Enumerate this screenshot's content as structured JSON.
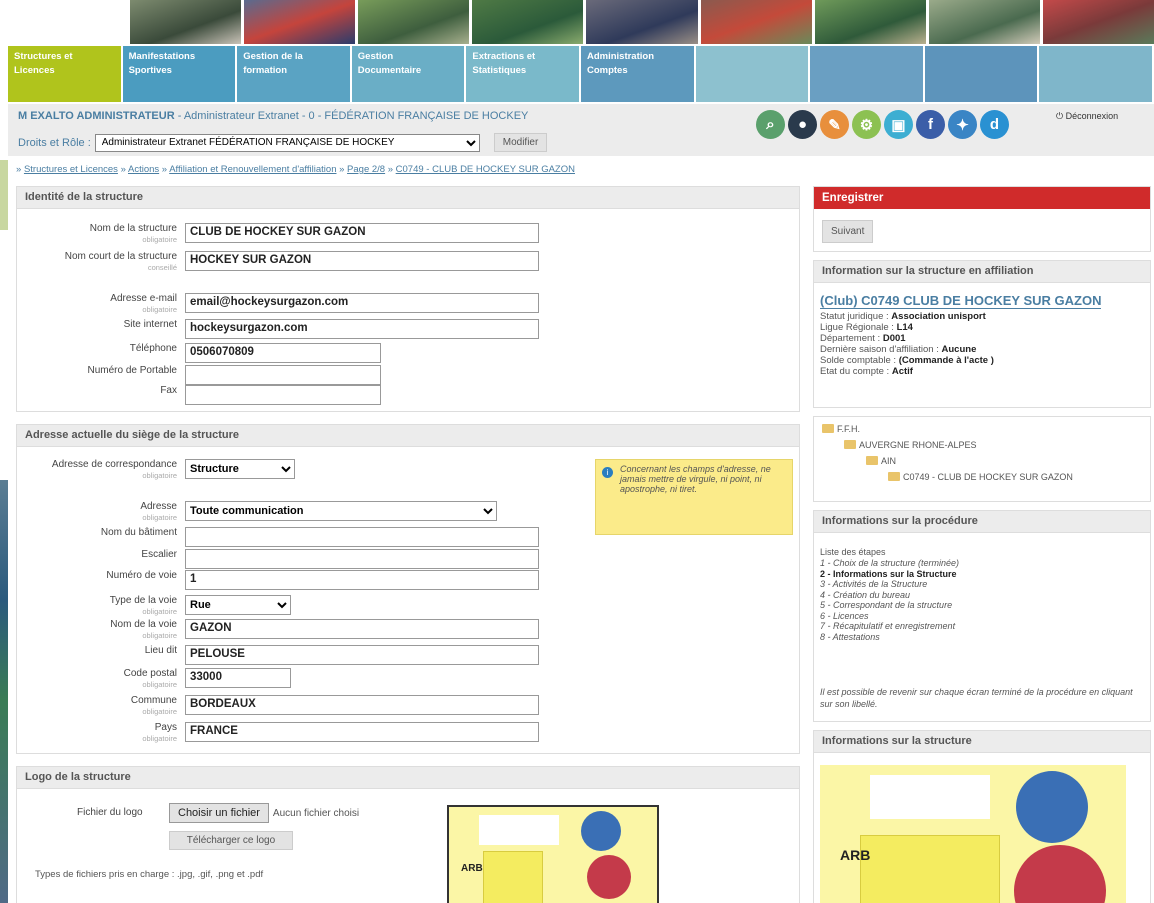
{
  "nav": {
    "items": [
      {
        "label": "Structures et Licences",
        "color": "#b0c41c"
      },
      {
        "label": "Manifestations Sportives",
        "color": "#4b9cc0"
      },
      {
        "label": "Gestion de la formation",
        "color": "#5aa3c3"
      },
      {
        "label": "Gestion Documentaire",
        "color": "#6aaec6"
      },
      {
        "label": "Extractions et Statistiques",
        "color": "#7ab9ca"
      },
      {
        "label": "Administration Comptes",
        "color": "#5d99bd"
      },
      {
        "label": "",
        "color": "#8dc1cf"
      },
      {
        "label": "",
        "color": "#6a9fc2"
      },
      {
        "label": "",
        "color": "#5d94bb"
      },
      {
        "label": "",
        "color": "#7fb6ca"
      }
    ]
  },
  "user": {
    "name": "M EXALTO ADMINISTRATEUR",
    "info": "- Administrateur Extranet - 0 - FÉDÉRATION FRANÇAISE DE HOCKEY",
    "role_label": "Droits et Rôle :",
    "role_value": "Administrateur Extranet FÉDÉRATION FRANÇAISE DE HOCKEY",
    "modify_label": "Modifier",
    "logout_label": "Déconnexion"
  },
  "icons": [
    {
      "name": "search-icon",
      "glyph": "⌕",
      "color": "#5aa06c"
    },
    {
      "name": "user-icon",
      "glyph": "●",
      "color": "#2a3a4c"
    },
    {
      "name": "edit-icon",
      "glyph": "✎",
      "color": "#e88f3c"
    },
    {
      "name": "settings-icon",
      "glyph": "⚙",
      "color": "#8cc152"
    },
    {
      "name": "lock-icon",
      "glyph": "▣",
      "color": "#3caed2"
    },
    {
      "name": "facebook-icon",
      "glyph": "f",
      "color": "#3b5ea8"
    },
    {
      "name": "twitter-icon",
      "glyph": "✦",
      "color": "#3a85c5"
    },
    {
      "name": "dailymotion-icon",
      "glyph": "d",
      "color": "#2a91d2"
    }
  ],
  "breadcrumb": {
    "items": [
      "Structures et Licences",
      "Actions",
      "Affiliation et Renouvellement d'affiliation",
      "Page 2/8",
      "C0749 - CLUB DE HOCKEY SUR GAZON"
    ]
  },
  "identity": {
    "title": "Identité de la structure",
    "fields": [
      {
        "label": "Nom de la structure",
        "note": "obligatoire",
        "value": "CLUB DE HOCKEY SUR GAZON"
      },
      {
        "label": "Nom court de la structure",
        "note": "conseillé",
        "value": "HOCKEY SUR GAZON"
      },
      {
        "label": "Adresse e-mail",
        "note": "obligatoire",
        "value": "email@hockeysurgazon.com"
      },
      {
        "label": "Site internet",
        "note": "",
        "value": "hockeysurgazon.com"
      },
      {
        "label": "Téléphone",
        "note": "",
        "value": "0506070809"
      },
      {
        "label": "Numéro de Portable",
        "note": "",
        "value": ""
      },
      {
        "label": "Fax",
        "note": "",
        "value": ""
      }
    ]
  },
  "address": {
    "title": "Adresse actuelle du siège de la structure",
    "info": "Concernant les champs d'adresse, ne jamais mettre de virgule, ni point, ni apostrophe, ni tiret.",
    "fields": [
      {
        "label": "Adresse de correspondance",
        "note": "obligatoire",
        "value": "Structure",
        "type": "select"
      },
      {
        "label": "Adresse",
        "note": "obligatoire",
        "value": "Toute communication",
        "type": "select"
      },
      {
        "label": "Nom du bâtiment",
        "note": "",
        "value": "",
        "type": "text"
      },
      {
        "label": "Escalier",
        "note": "",
        "value": "",
        "type": "text"
      },
      {
        "label": "Numéro de voie",
        "note": "",
        "value": "1",
        "type": "text"
      },
      {
        "label": "Type de la voie",
        "note": "obligatoire",
        "value": "Rue",
        "type": "select"
      },
      {
        "label": "Nom de la voie",
        "note": "obligatoire",
        "value": "GAZON",
        "type": "text"
      },
      {
        "label": "Lieu dit",
        "note": "",
        "value": "PELOUSE",
        "type": "text"
      },
      {
        "label": "Code postal",
        "note": "obligatoire",
        "value": "33000",
        "type": "text"
      },
      {
        "label": "Commune",
        "note": "obligatoire",
        "value": "BORDEAUX",
        "type": "text"
      },
      {
        "label": "Pays",
        "note": "obligatoire",
        "value": "FRANCE",
        "type": "text"
      }
    ]
  },
  "logo": {
    "title": "Logo de la structure",
    "file_label": "Fichier du logo",
    "choose_label": "Choisir un fichier",
    "no_file": "Aucun fichier choisi",
    "upload_label": "Télécharger ce logo",
    "types": "Types de fichiers pris en charge : .jpg, .gif, .png et .pdf"
  },
  "right": {
    "save_title": "Enregistrer",
    "next_label": "Suivant",
    "affil_title": "Information sur la structure en affiliation",
    "club_name": "(Club) C0749 CLUB DE HOCKEY SUR GAZON",
    "details": [
      {
        "label": "Statut juridique : ",
        "value": "Association unisport"
      },
      {
        "label": "Ligue Régionale : ",
        "value": "L14"
      },
      {
        "label": "Département : ",
        "value": "D001"
      },
      {
        "label": "Dernière saison d'affiliation : ",
        "value": "Aucune"
      },
      {
        "label": "Solde comptable : ",
        "value": "(Commande à l'acte )"
      },
      {
        "label": "Etat du compte : ",
        "value": "Actif"
      }
    ],
    "tree": [
      "F.F.H.",
      "AUVERGNE RHONE-ALPES",
      "AIN",
      "C0749 - CLUB DE HOCKEY SUR GAZON"
    ],
    "proc_title": "Informations sur la procédure",
    "steps_label": "Liste des étapes",
    "steps": [
      "1 - Choix de la structure (terminée)",
      "2 - Informations sur la Structure",
      "3 - Activités de la Structure",
      "4 - Création du bureau",
      "5 - Correspondant de la structure",
      "6 - Licences",
      "7 - Récapitulatif et enregistrement",
      "8 - Attestations"
    ],
    "proc_note": "Il est possible de revenir sur chaque écran terminé de la procédure en cliquant sur son libellé.",
    "struct_title": "Informations sur la structure",
    "poster_letters": "ARB"
  }
}
